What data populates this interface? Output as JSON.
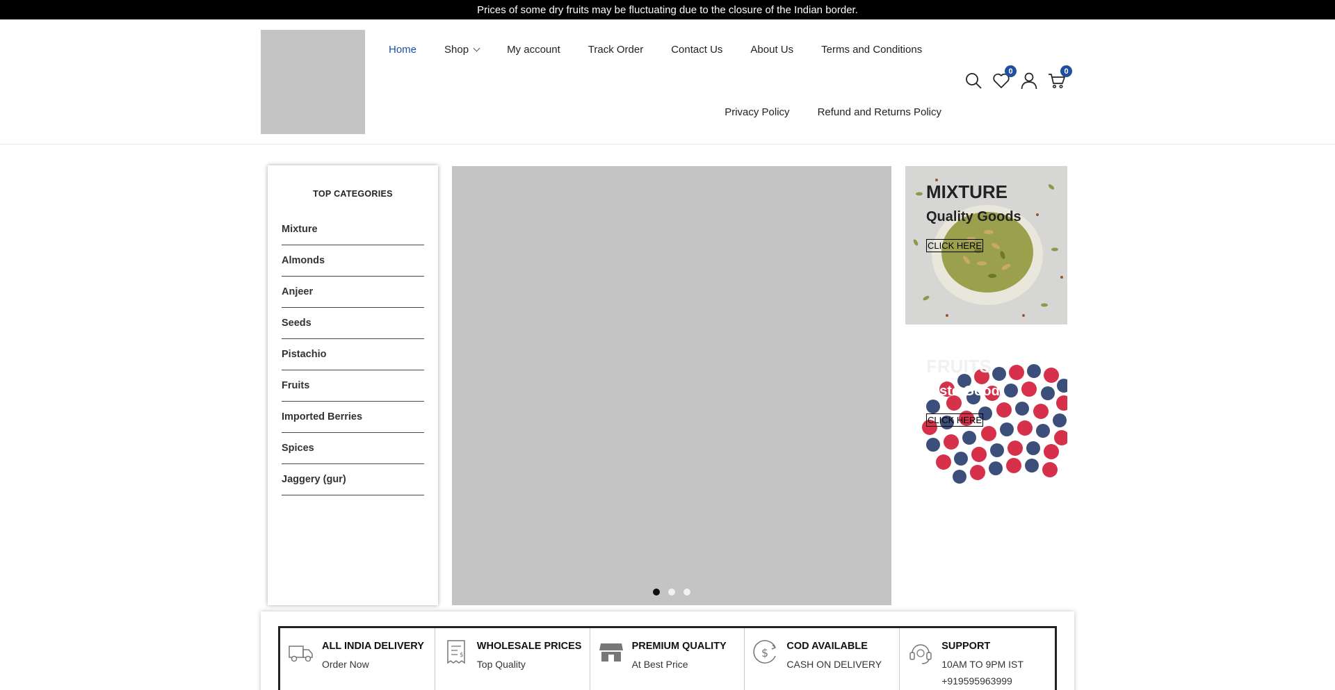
{
  "announcement": "Prices of some dry fruits may be fluctuating due to the closure of the Indian border.",
  "nav": {
    "row1": [
      {
        "label": "Home",
        "active": true
      },
      {
        "label": "Shop",
        "dropdown": true
      },
      {
        "label": "My account"
      },
      {
        "label": "Track Order"
      },
      {
        "label": "Contact Us"
      },
      {
        "label": "About Us"
      },
      {
        "label": "Terms and Conditions"
      }
    ],
    "row2": [
      {
        "label": "Privacy Policy"
      },
      {
        "label": "Refund and Returns Policy"
      }
    ]
  },
  "header_icons": {
    "wishlist_count": "0",
    "cart_count": "0"
  },
  "colors": {
    "accent": "#1f4fa0",
    "announce_bg": "#000000",
    "placeholder": "#c4c4c4"
  },
  "categories": {
    "title": "TOP CATEGORIES",
    "items": [
      "Mixture",
      "Almonds",
      "Anjeer",
      "Seeds",
      "Pistachio",
      "Fruits",
      "Imported Berries",
      "Spices",
      "Jaggery (gur)"
    ]
  },
  "slider": {
    "active_index": 0,
    "count": 3
  },
  "banners": [
    {
      "title": "MIXTURE",
      "subtitle": "Quality Goods",
      "button": "CLICK HERE"
    },
    {
      "title": "FRUITS",
      "subtitle": "aste Good",
      "button": "CLICK HERE"
    }
  ],
  "features": [
    {
      "icon": "truck-icon",
      "title": "ALL INDIA DELIVERY",
      "sub": "Order Now"
    },
    {
      "icon": "receipt-icon",
      "title": "WHOLESALE PRICES",
      "sub": "Top Quality"
    },
    {
      "icon": "store-icon",
      "title": "PREMIUM QUALITY",
      "sub": "At Best Price"
    },
    {
      "icon": "dollar-refresh-icon",
      "title": "COD AVAILABLE",
      "sub": "CASH ON DELIVERY"
    },
    {
      "icon": "headset-icon",
      "title": "SUPPORT",
      "sub": "10AM TO 9PM IST",
      "sub2": "+919595963999"
    }
  ]
}
